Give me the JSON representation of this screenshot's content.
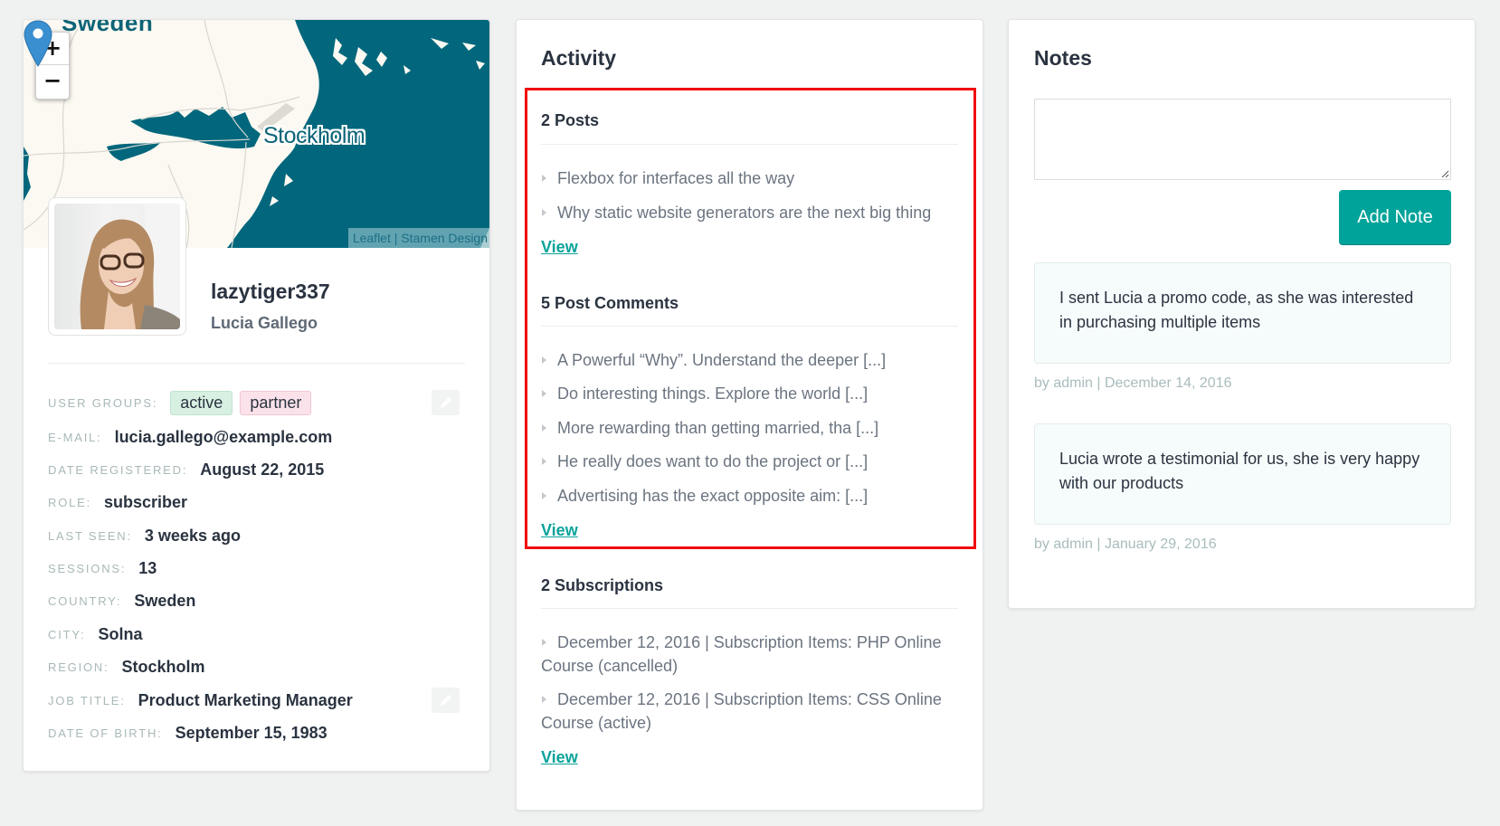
{
  "profile": {
    "map": {
      "country_label": "Sweden",
      "city_label": "Stockholm",
      "zoom_in": "+",
      "zoom_out": "−",
      "attribution": "Leaflet | Stamen Design",
      "marker_icon": "map-pin-icon",
      "colors": {
        "land": "#fcf9f2",
        "water": "#02677c",
        "marker": "#3a8fd0"
      }
    },
    "username": "lazytiger337",
    "full_name": "Lucia Gallego",
    "fields": [
      {
        "label": "User groups:",
        "type": "tags",
        "tags": [
          {
            "text": "active",
            "color": "#d8f0e2"
          },
          {
            "text": "partner",
            "color": "#fbe2ea"
          }
        ]
      },
      {
        "label": "E-mail:",
        "value": "lucia.gallego@example.com"
      },
      {
        "label": "Date registered:",
        "value": "August 22, 2015"
      },
      {
        "label": "Role:",
        "value": "subscriber"
      },
      {
        "label": "Last seen:",
        "value": "3 weeks ago"
      },
      {
        "label": "Sessions:",
        "value": "13"
      },
      {
        "label": "Country:",
        "value": "Sweden"
      },
      {
        "label": "City:",
        "value": "Solna"
      },
      {
        "label": "Region:",
        "value": "Stockholm"
      },
      {
        "label": "Job title:",
        "value": "Product Marketing Manager"
      },
      {
        "label": "Date of birth:",
        "value": "September 15, 1983"
      }
    ],
    "edit_icon": "pencil-icon"
  },
  "activity": {
    "title": "Activity",
    "highlight_color": "#f20d0d",
    "sections": [
      {
        "title": "2 Posts",
        "items": [
          "Flexbox for interfaces all the way",
          "Why static website generators are the next big thing"
        ],
        "link": "View"
      },
      {
        "title": "5 Post Comments",
        "items": [
          "A Powerful “Why”. Understand the deeper [...]",
          "Do interesting things. Explore the world [...]",
          "More rewarding than getting married, tha [...]",
          "He really does want to do the project or [...]",
          "Advertising has the exact opposite aim: [...]"
        ],
        "link": "View"
      },
      {
        "title": "2 Subscriptions",
        "items": [
          "December 12, 2016 | Subscription Items: PHP Online Course (cancelled)",
          "December 12, 2016 | Subscription Items: CSS Online Course (active)"
        ],
        "link": "View"
      }
    ],
    "link_color": "#0aa39a"
  },
  "notes": {
    "title": "Notes",
    "textarea_value": "",
    "textarea_placeholder": "",
    "add_button": "Add Note",
    "accent": "#00a39a",
    "items": [
      {
        "text": "I sent Lucia a promo code, as she was interested in purchasing multiple items",
        "meta": "by admin | December 14, 2016"
      },
      {
        "text": "Lucia wrote a testimonial for us, she is very happy with our products",
        "meta": "by admin | January 29, 2016"
      }
    ]
  }
}
